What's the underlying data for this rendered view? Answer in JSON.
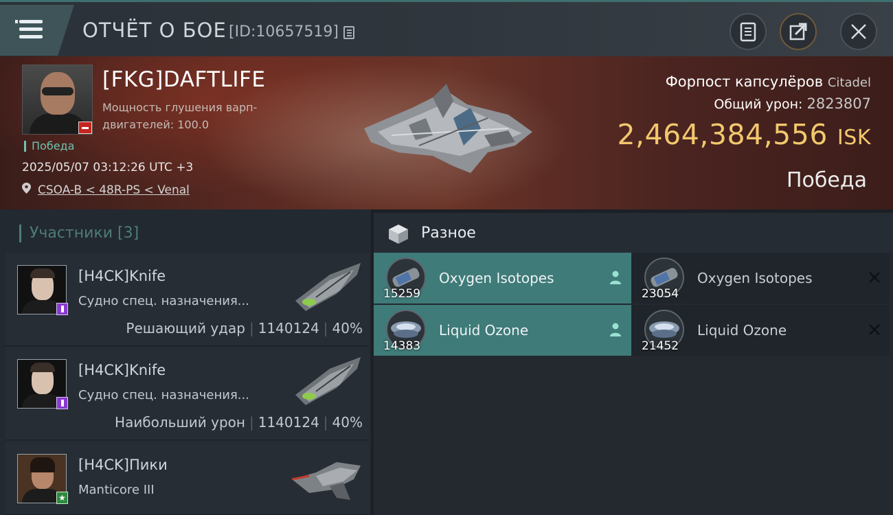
{
  "header": {
    "title": "ОТЧЁТ О БОЕ",
    "report_id": "[ID:10657519]"
  },
  "victim": {
    "name": "[FKG]DAFTLIFE",
    "stat_text": "Мощность глушения варп-двигателей: 100.0",
    "result_tag": "Победа",
    "datetime": "2025/05/07 03:12:26 UTC +3",
    "location": "CSOA-B < 48R-PS < Venal",
    "structure_name": "Форпост капсулёров",
    "structure_type": "Citadel",
    "total_damage_label": "Общий урон:",
    "total_damage_value": "2823807",
    "isk_value": "2,464,384,556",
    "isk_unit": "ISK",
    "result": "Победа"
  },
  "participants": {
    "header": "Участники [3]",
    "items": [
      {
        "name": "[H4CK]Knife",
        "ship": "Судно спец. назначения...",
        "role": "Решающий удар",
        "damage": "1140124",
        "percent": "40%",
        "badge": "purple"
      },
      {
        "name": "[H4CK]Knife",
        "ship": "Судно спец. назначения...",
        "role": "Наибольший урон",
        "damage": "1140124",
        "percent": "40%",
        "badge": "purple"
      },
      {
        "name": "[H4CK]Пики",
        "ship": "Manticore III",
        "badge": "green-star"
      }
    ]
  },
  "misc": {
    "title": "Разное",
    "items": [
      {
        "name": "Oxygen Isotopes",
        "qty": "15259",
        "state": "dropped",
        "icon": "oxygen-isotopes-icon"
      },
      {
        "name": "Oxygen Isotopes",
        "qty": "23054",
        "state": "destroyed",
        "icon": "oxygen-isotopes-icon"
      },
      {
        "name": "Liquid Ozone",
        "qty": "14383",
        "state": "dropped",
        "icon": "liquid-ozone-icon"
      },
      {
        "name": "Liquid Ozone",
        "qty": "21452",
        "state": "destroyed",
        "icon": "liquid-ozone-icon"
      }
    ]
  },
  "colors": {
    "accent_teal": "#3f7b79",
    "isk_gold": "#f2c86e",
    "victory_green": "#6ec4b0",
    "badge_purple": "#8b3bd1",
    "badge_red": "#c4251f"
  }
}
